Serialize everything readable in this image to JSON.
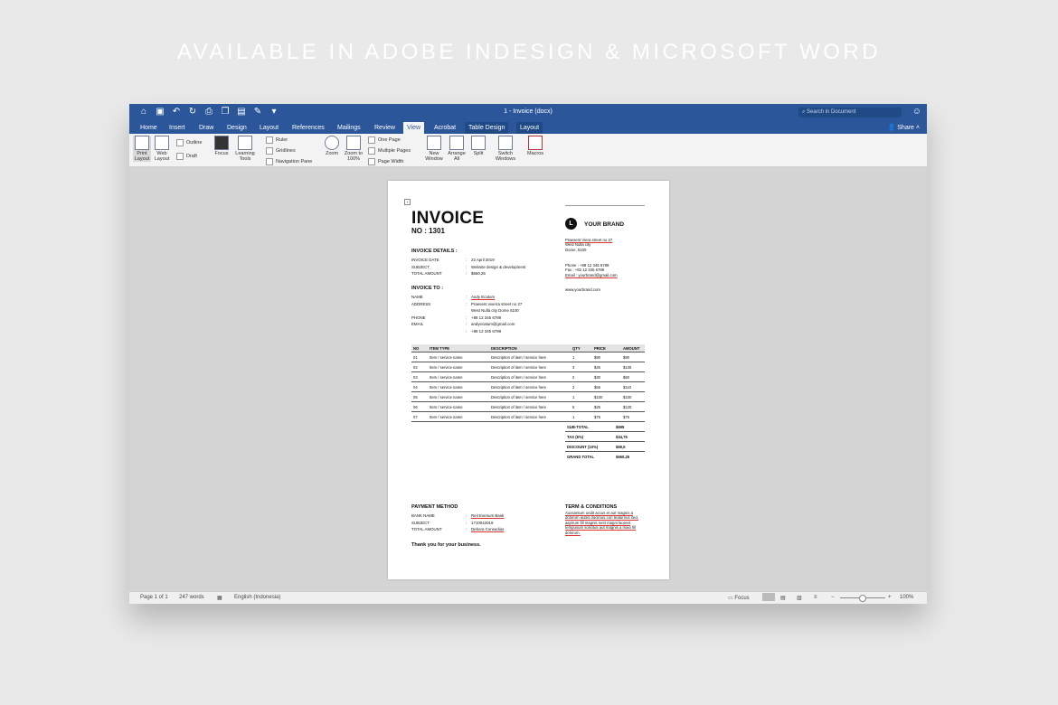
{
  "headline": "AVAILABLE IN ADOBE INDESIGN & MICROSOFT WORD",
  "window": {
    "title": "1 - Invoice (docx)",
    "search_placeholder": "Search in Document",
    "share_label": "Share"
  },
  "tabs": [
    {
      "label": "Home"
    },
    {
      "label": "Insert"
    },
    {
      "label": "Draw"
    },
    {
      "label": "Design"
    },
    {
      "label": "Layout"
    },
    {
      "label": "References"
    },
    {
      "label": "Mailings"
    },
    {
      "label": "Review"
    },
    {
      "label": "View"
    },
    {
      "label": "Acrobat"
    },
    {
      "label": "Table Design"
    },
    {
      "label": "Layout"
    }
  ],
  "ribbon": {
    "print_layout": "Print Layout",
    "web_layout": "Web Layout",
    "outline": "Outline",
    "draft": "Draft",
    "focus": "Focus",
    "learning_tools": "Learning Tools",
    "ruler": "Ruler",
    "gridlines": "Gridlines",
    "navigation_pane": "Navigation Pane",
    "zoom": "Zoom",
    "zoom_100": "Zoom to 100%",
    "one_page": "One Page",
    "multiple_pages": "Multiple Pages",
    "page_width": "Page Width",
    "new_window": "New Window",
    "arrange_all": "Arrange All",
    "split": "Split",
    "switch_windows": "Switch Windows",
    "macros": "Macros"
  },
  "invoice": {
    "title": "INVOICE",
    "number": "NO : 1301",
    "details_heading": "INVOICE DETAILS :",
    "details": [
      {
        "k": "INVOICE DATE",
        "v": "22 April 2019"
      },
      {
        "k": "SUBJECT",
        "v": "Website design & development"
      },
      {
        "k": "TOTAL AMOUNT",
        "v": "$660,25"
      }
    ],
    "to_heading": "INVOICE TO :",
    "to": [
      {
        "k": "NAME",
        "v": "Andy Ecatum"
      },
      {
        "k": "ADDRESS",
        "v": "Praesent viverra street no 27"
      },
      {
        "k": "",
        "v": "West Nulla city Dome 5100"
      },
      {
        "k": "",
        "v": " "
      },
      {
        "k": "PHONE",
        "v": "+88 12 345 6789"
      },
      {
        "k": "EMAIL",
        "v": "andyecatum@gmail.com"
      },
      {
        "k": "",
        "v": "+88 12 345 6789"
      }
    ],
    "brand": {
      "logo_letter": "L",
      "name": "YOUR BRAND",
      "address1": "Praesent Viera street no 27",
      "address2": "West Nulla city",
      "address3": "Dome, 5100",
      "phone": "Phone : +88 12 345 6789",
      "fax": "Fax : +82 12 345 6789",
      "email": "Email : yourbrand@gmail.com",
      "web": "www.yourbrand.com"
    },
    "table_headers": [
      "NO",
      "ITEM TYPE",
      "DESCRIPTION",
      "QTY",
      "PRICE",
      "AMOUNT"
    ],
    "items": [
      [
        "01",
        "Item / service name",
        "Description of item / service here",
        "1",
        "$90",
        "$90"
      ],
      [
        "02",
        "Item / service name",
        "Description of item / service here",
        "3",
        "$45",
        "$135"
      ],
      [
        "03",
        "Item / service name",
        "Description of item / service here",
        "2",
        "$30",
        "$60"
      ],
      [
        "04",
        "Item / service name",
        "Description of item / service here",
        "2",
        "$55",
        "$110"
      ],
      [
        "05",
        "Item / service name",
        "Description of item / service here",
        "1",
        "$100",
        "$100"
      ],
      [
        "06",
        "Item / service name",
        "Description of item / service here",
        "5",
        "$25",
        "$125"
      ],
      [
        "07",
        "Item / service name",
        "Description of item / service here",
        "1",
        "$75",
        "$75"
      ]
    ],
    "totals": [
      {
        "k": "SUB-TOTAL",
        "v": "$695"
      },
      {
        "k": "TAX (5%)",
        "v": "$34,75"
      },
      {
        "k": "DISCOUNT (10%)",
        "v": "$69,5"
      },
      {
        "k": "GRAND TOTAL",
        "v": "$660,25"
      }
    ],
    "payment_heading": "PAYMENT METHOD",
    "payment": [
      {
        "k": "BANK NAME",
        "v": "Reit Evenum Bank"
      },
      {
        "k": "SUBJECT",
        "v": "1710042019"
      },
      {
        "k": "TOTAL AMOUNT",
        "v": "Debora Consedius"
      }
    ],
    "terms_heading": "TERM & CONDITIONS",
    "terms_text": "Auxsantum undit accus et aut magnis a dolorum autes ducimus con teaturnus sed, aspirum fill magnis nest magni laoreet tempusum solicitus aut magnis a maio fill dolorum.",
    "thanks": "Thank you for your business."
  },
  "status": {
    "page": "Page 1 of 1",
    "words": "247 words",
    "language": "English (Indonesia)",
    "focus": "Focus",
    "zoom": "100%"
  }
}
